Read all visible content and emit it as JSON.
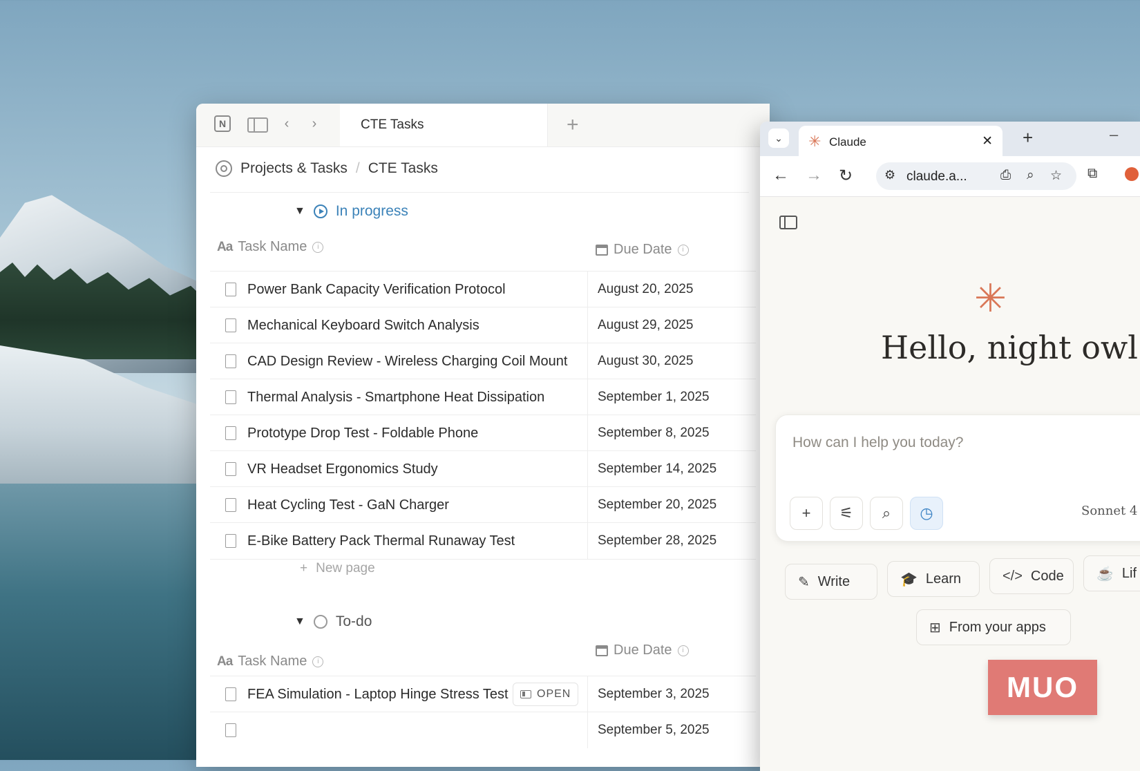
{
  "notion": {
    "tab_title": "CTE Tasks",
    "breadcrumb": [
      "Projects & Tasks",
      "CTE Tasks"
    ],
    "groups": [
      {
        "status": "In progress",
        "columns": {
          "task": "Task Name",
          "due": "Due Date"
        },
        "tasks": [
          {
            "name": "Power Bank Capacity Verification Protocol",
            "due": "August 20, 2025"
          },
          {
            "name": "Mechanical Keyboard Switch Analysis",
            "due": "August 29, 2025"
          },
          {
            "name": "CAD Design Review - Wireless Charging Coil Mount",
            "due": "August 30, 2025"
          },
          {
            "name": "Thermal Analysis - Smartphone Heat Dissipation",
            "due": "September 1, 2025"
          },
          {
            "name": "Prototype Drop Test - Foldable Phone",
            "due": "September 8, 2025"
          },
          {
            "name": "VR Headset Ergonomics Study",
            "due": "September 14, 2025"
          },
          {
            "name": "Heat Cycling Test - GaN Charger",
            "due": "September 20, 2025"
          },
          {
            "name": "E-Bike Battery Pack Thermal Runaway Test",
            "due": "September 28, 2025"
          }
        ],
        "new_page": "New page"
      },
      {
        "status": "To-do",
        "columns": {
          "task": "Task Name",
          "due": "Due Date"
        },
        "tasks": [
          {
            "name": "FEA Simulation - Laptop Hinge Stress Test",
            "due": "September 3, 2025",
            "open_label": "OPEN"
          },
          {
            "name": "",
            "due": "September 5, 2025"
          }
        ]
      }
    ]
  },
  "browser": {
    "tab_title": "Claude",
    "url": "claude.a...",
    "claude": {
      "greeting": "Hello, night owl",
      "placeholder": "How can I help you today?",
      "model": "Sonnet 4",
      "chips": [
        "Write",
        "Learn",
        "Code",
        "Lif",
        "From your apps"
      ]
    }
  },
  "watermark": "MUO",
  "colors": {
    "claude_accent": "#d97757",
    "status_blue": "#3b82b8",
    "muo_badge": "#e07a75"
  }
}
